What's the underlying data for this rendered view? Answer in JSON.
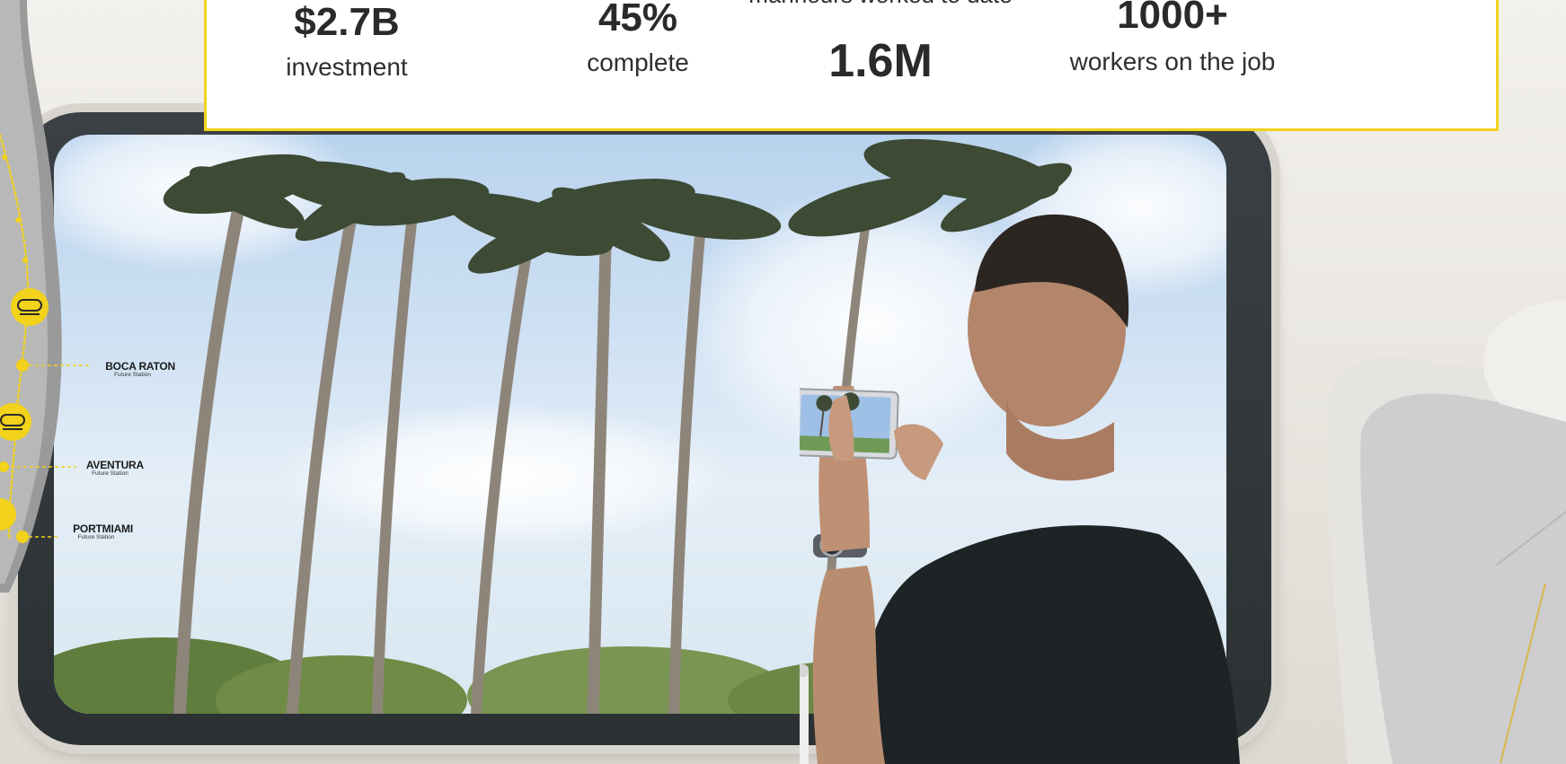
{
  "stats": [
    {
      "value": "$2.7B",
      "label": "investment"
    },
    {
      "value": "45%",
      "label": "complete"
    },
    {
      "value": "1.6M",
      "label": "manhours worked to date"
    },
    {
      "value": "1000+",
      "label": "workers on the job"
    }
  ],
  "route": {
    "stations": [
      {
        "name": "BOCA RATON",
        "sub": "Future Station"
      },
      {
        "name": "AVENTURA",
        "sub": "Future Station"
      },
      {
        "name": "PORTMIAMI",
        "sub": "Future Station"
      }
    ]
  },
  "colors": {
    "accent_yellow": "#f2d21b",
    "card_bg": "#ffffff",
    "frame_dark": "#2f3538",
    "sky": "#cfe1f3"
  },
  "icons": [
    "train-icon",
    "palm-tree-icon"
  ]
}
